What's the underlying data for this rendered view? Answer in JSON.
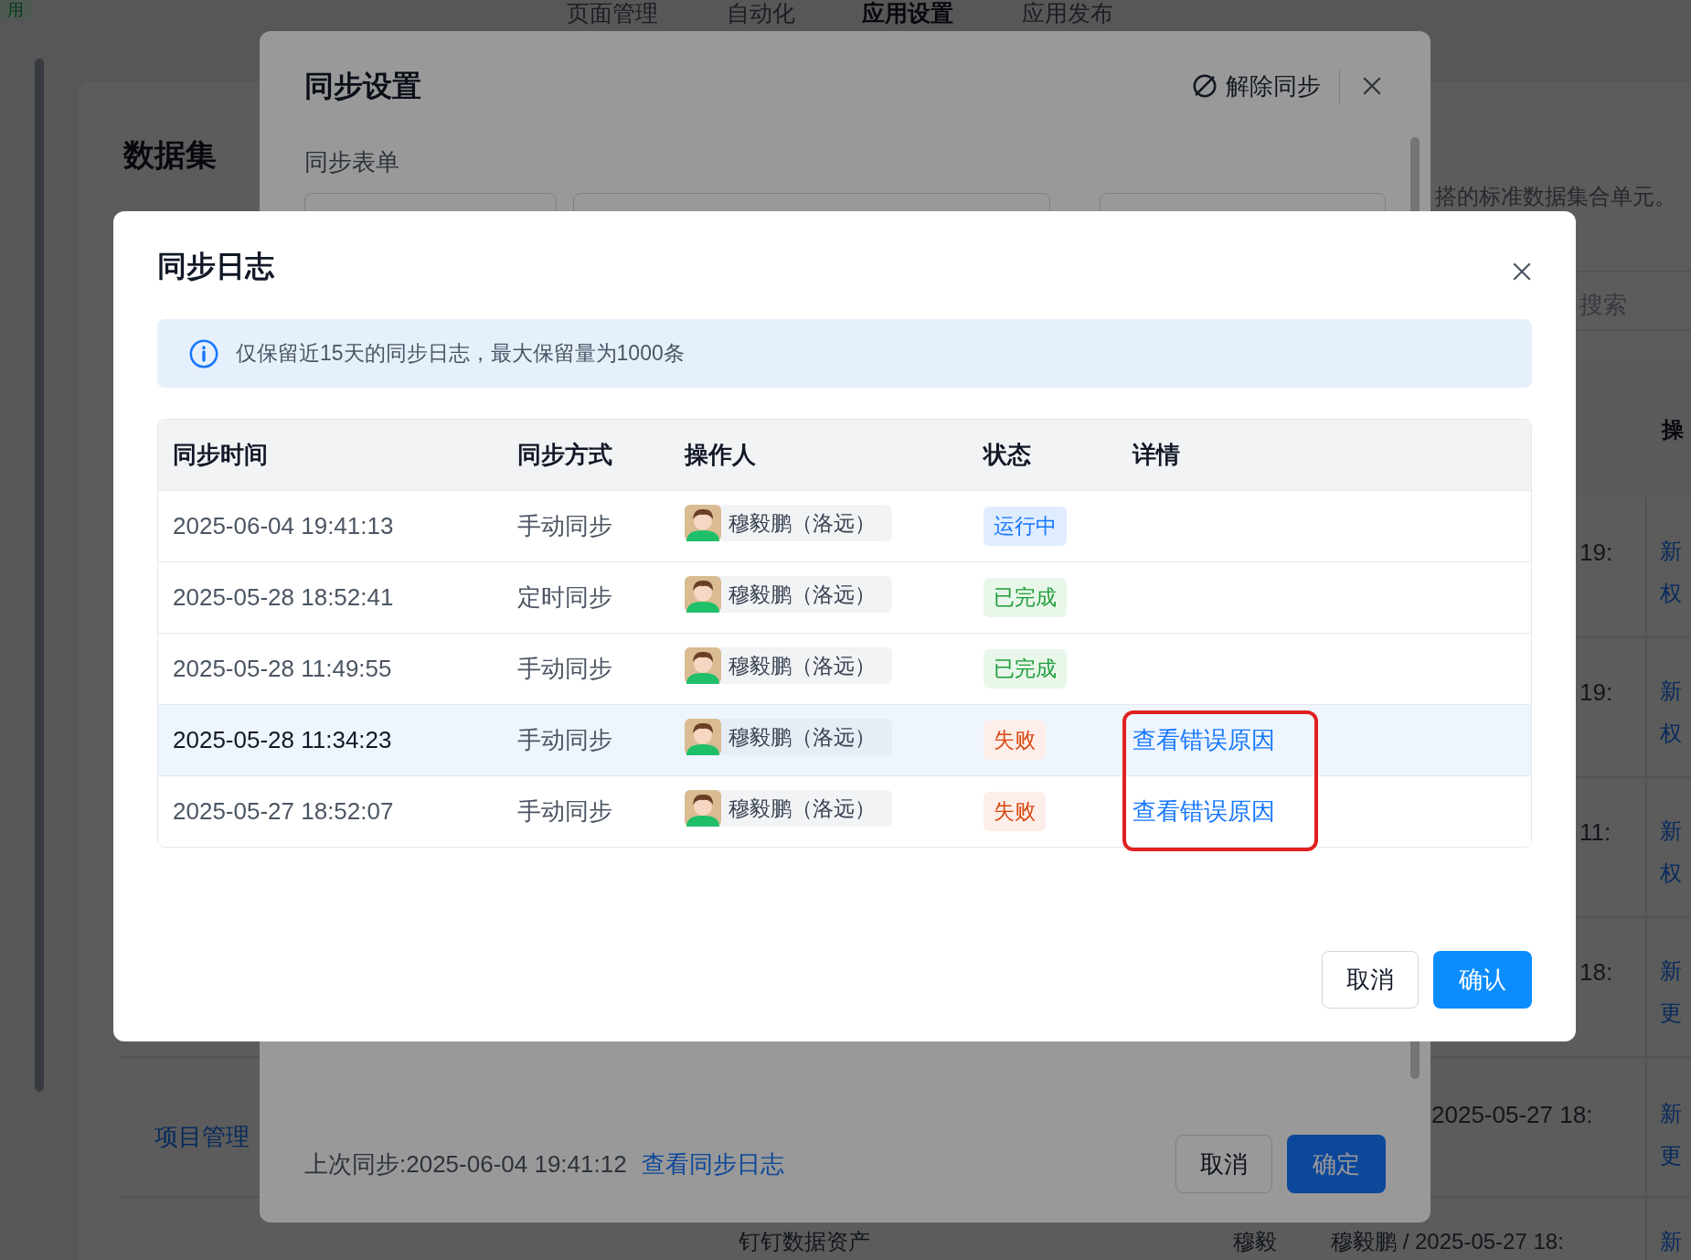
{
  "nav": {
    "badge": "用",
    "tabs": [
      {
        "label": "页面管理",
        "selected": false
      },
      {
        "label": "自动化",
        "selected": false
      },
      {
        "label": "应用设置",
        "selected": true
      },
      {
        "label": "应用发布",
        "selected": false
      }
    ]
  },
  "page": {
    "title": "数据集",
    "description_tail": "搭的标准数据集合单元。",
    "search_placeholder": "搜索",
    "ops_header": "操",
    "rows": [
      {
        "name": "",
        "time": "19:",
        "ops": [
          "新",
          "权"
        ]
      },
      {
        "name": "",
        "time": "19:",
        "ops": [
          "新",
          "权"
        ]
      },
      {
        "name": "",
        "time": "11:",
        "ops": [
          "新",
          "权"
        ]
      },
      {
        "name": "",
        "time": "18:",
        "ops": [
          "新",
          "更"
        ]
      },
      {
        "name": "项目管理",
        "time": "2025-05-27 18:",
        "ops": [
          "新",
          "更"
        ]
      }
    ],
    "last_row": {
      "source": "钉钉数据资产",
      "owner": "穆毅",
      "time": "穆毅鹏 / 2025-05-27 18:",
      "op": "新"
    }
  },
  "sync_settings": {
    "title": "同步设置",
    "unsync_label": "解除同步",
    "section_label": "同步表单",
    "last_sync": "上次同步:2025-06-04 19:41:12",
    "log_link": "查看同步日志",
    "buttons": [
      "取消",
      "确定"
    ]
  },
  "sync_log": {
    "title": "同步日志",
    "notice": "仅保留近15天的同步日志，最大保留量为1000条",
    "columns": [
      "同步时间",
      "同步方式",
      "操作人",
      "状态",
      "详情"
    ],
    "rows": [
      {
        "time": "2025-06-04 19:41:13",
        "method": "手动同步",
        "operator": "穆毅鹏（洛远）",
        "status": {
          "kind": "running",
          "label": "运行中"
        },
        "highlighted": false
      },
      {
        "time": "2025-05-28 18:52:41",
        "method": "定时同步",
        "operator": "穆毅鹏（洛远）",
        "status": {
          "kind": "done",
          "label": "已完成"
        },
        "highlighted": false
      },
      {
        "time": "2025-05-28 11:49:55",
        "method": "手动同步",
        "operator": "穆毅鹏（洛远）",
        "status": {
          "kind": "done",
          "label": "已完成"
        },
        "highlighted": false
      },
      {
        "time": "2025-05-28 11:34:23",
        "method": "手动同步",
        "operator": "穆毅鹏（洛远）",
        "status": {
          "kind": "failed",
          "label": "失败"
        },
        "detail": "查看错误原因",
        "highlighted": true
      },
      {
        "time": "2025-05-27 18:52:07",
        "method": "手动同步",
        "operator": "穆毅鹏（洛远）",
        "status": {
          "kind": "failed",
          "label": "失败"
        },
        "detail": "查看错误原因",
        "highlighted": false
      }
    ],
    "buttons": [
      "取消",
      "确认"
    ]
  }
}
